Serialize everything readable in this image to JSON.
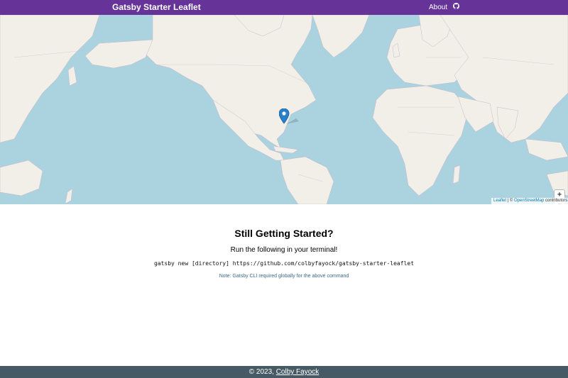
{
  "header": {
    "title": "Gatsby Starter Leaflet",
    "nav_about": "About",
    "github_icon": "github-icon",
    "bg_color": "#663399"
  },
  "map": {
    "ocean_color": "#aad3df",
    "land_color": "#f2efe9",
    "zoom_in_label": "+",
    "zoom_out_label": "−",
    "attribution_leaflet": "Leaflet",
    "attribution_sep": " | © ",
    "attribution_osm": "OpenStreetMap",
    "attribution_suffix": " contributors",
    "marker_icon": "map-marker-icon",
    "marker_color": "#2a81cb"
  },
  "content": {
    "heading": "Still Getting Started?",
    "subheading": "Run the following in your terminal!",
    "command": "gatsby new [directory] https://github.com/colbyfayock/gatsby-starter-leaflet",
    "note": "Note: Gatsby CLI required globally for the above command"
  },
  "footer": {
    "copyright": "© 2023, ",
    "author": "Colby Fayock",
    "bg_color": "#455a64"
  }
}
